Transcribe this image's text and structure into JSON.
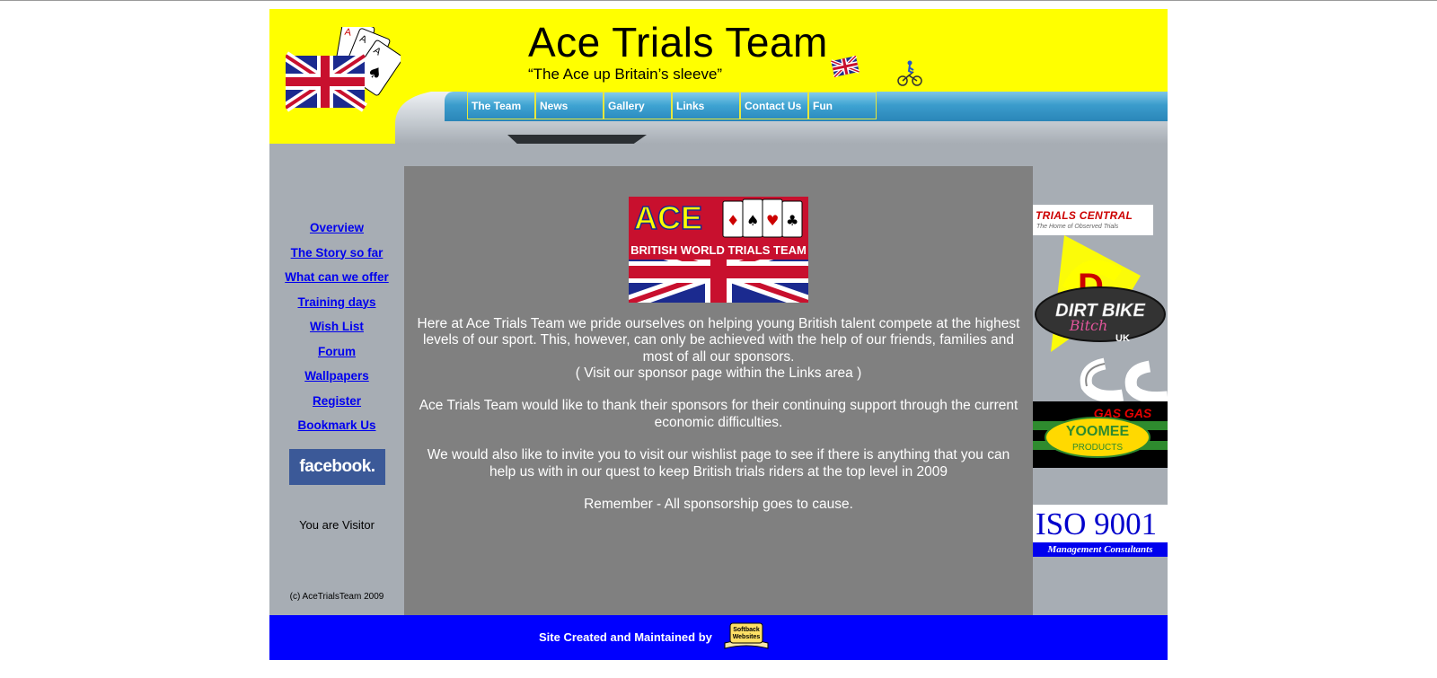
{
  "header": {
    "title": "Ace Trials Team",
    "tagline": "“The Ace up Britain’s sleeve”"
  },
  "nav": [
    {
      "label": "The Team"
    },
    {
      "label": "News"
    },
    {
      "label": "Gallery"
    },
    {
      "label": "Links"
    },
    {
      "label": "Contact Us"
    },
    {
      "label": "Fun"
    }
  ],
  "sidebar": {
    "links": [
      {
        "label": "Overview"
      },
      {
        "label": "The Story so far"
      },
      {
        "label": "What can we offer"
      },
      {
        "label": "Training days"
      },
      {
        "label": "Wish List"
      },
      {
        "label": "Forum"
      },
      {
        "label": "Wallpapers"
      },
      {
        "label": "Register"
      },
      {
        "label": "Bookmark Us"
      }
    ],
    "facebook": "facebook.",
    "visitor": "You are Visitor",
    "copyright": "(c) AceTrialsTeam 2009"
  },
  "banner": {
    "ace": "ACE",
    "subtitle": "BRITISH WORLD TRIALS TEAM"
  },
  "main": {
    "p1_a": "Here at Ace Trials Team we pride ourselves on helping young British talent compete at the highest levels of our sport.  This, however,  can only be achieved with the help of our friends, families and most of all our sponsors.",
    "p1_b": "( Visit our sponsor page within the Links area )",
    "p2": "Ace Trials Team would like to thank their sponsors for their continuing support through the current economic difficulties.",
    "p3": "We would also like to invite you to visit our wishlist page to see if there is anything that you can help us with in our quest to keep British trials riders at the top level in 2009",
    "p4": "Remember - All sponsorship goes to cause."
  },
  "sponsors": {
    "trials_central": "TRIALS CENTRAL",
    "trials_central_tag": "The Home of Observed Trials",
    "dirtbike": "DIRT BIKE",
    "dirtbike_script": "Bitch",
    "dirtbike_uk": "UK",
    "gasgas": "GAS GAS",
    "yoomee": "YOOMEE",
    "yoomee_sub": "PRODUCTS",
    "iso": "ISO 9001",
    "iso_sub": "Management Consultants"
  },
  "footer": {
    "text": "Site Created and Maintained by",
    "badge_line1": "Softback",
    "badge_line2": "Websites"
  },
  "colors": {
    "header_bg": "#ffff00",
    "footer_bg": "#0000ff",
    "main_bg": "#808080",
    "side_bg": "#a7adb4",
    "link": "#0000ee"
  }
}
